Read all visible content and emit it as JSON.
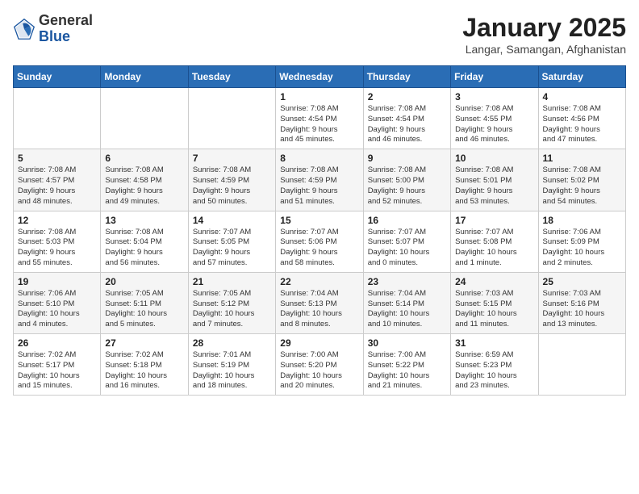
{
  "header": {
    "logo_general": "General",
    "logo_blue": "Blue",
    "title": "January 2025",
    "subtitle": "Langar, Samangan, Afghanistan"
  },
  "days_of_week": [
    "Sunday",
    "Monday",
    "Tuesday",
    "Wednesday",
    "Thursday",
    "Friday",
    "Saturday"
  ],
  "weeks": [
    [
      {
        "day": "",
        "info": ""
      },
      {
        "day": "",
        "info": ""
      },
      {
        "day": "",
        "info": ""
      },
      {
        "day": "1",
        "info": "Sunrise: 7:08 AM\nSunset: 4:54 PM\nDaylight: 9 hours\nand 45 minutes."
      },
      {
        "day": "2",
        "info": "Sunrise: 7:08 AM\nSunset: 4:54 PM\nDaylight: 9 hours\nand 46 minutes."
      },
      {
        "day": "3",
        "info": "Sunrise: 7:08 AM\nSunset: 4:55 PM\nDaylight: 9 hours\nand 46 minutes."
      },
      {
        "day": "4",
        "info": "Sunrise: 7:08 AM\nSunset: 4:56 PM\nDaylight: 9 hours\nand 47 minutes."
      }
    ],
    [
      {
        "day": "5",
        "info": "Sunrise: 7:08 AM\nSunset: 4:57 PM\nDaylight: 9 hours\nand 48 minutes."
      },
      {
        "day": "6",
        "info": "Sunrise: 7:08 AM\nSunset: 4:58 PM\nDaylight: 9 hours\nand 49 minutes."
      },
      {
        "day": "7",
        "info": "Sunrise: 7:08 AM\nSunset: 4:59 PM\nDaylight: 9 hours\nand 50 minutes."
      },
      {
        "day": "8",
        "info": "Sunrise: 7:08 AM\nSunset: 4:59 PM\nDaylight: 9 hours\nand 51 minutes."
      },
      {
        "day": "9",
        "info": "Sunrise: 7:08 AM\nSunset: 5:00 PM\nDaylight: 9 hours\nand 52 minutes."
      },
      {
        "day": "10",
        "info": "Sunrise: 7:08 AM\nSunset: 5:01 PM\nDaylight: 9 hours\nand 53 minutes."
      },
      {
        "day": "11",
        "info": "Sunrise: 7:08 AM\nSunset: 5:02 PM\nDaylight: 9 hours\nand 54 minutes."
      }
    ],
    [
      {
        "day": "12",
        "info": "Sunrise: 7:08 AM\nSunset: 5:03 PM\nDaylight: 9 hours\nand 55 minutes."
      },
      {
        "day": "13",
        "info": "Sunrise: 7:08 AM\nSunset: 5:04 PM\nDaylight: 9 hours\nand 56 minutes."
      },
      {
        "day": "14",
        "info": "Sunrise: 7:07 AM\nSunset: 5:05 PM\nDaylight: 9 hours\nand 57 minutes."
      },
      {
        "day": "15",
        "info": "Sunrise: 7:07 AM\nSunset: 5:06 PM\nDaylight: 9 hours\nand 58 minutes."
      },
      {
        "day": "16",
        "info": "Sunrise: 7:07 AM\nSunset: 5:07 PM\nDaylight: 10 hours\nand 0 minutes."
      },
      {
        "day": "17",
        "info": "Sunrise: 7:07 AM\nSunset: 5:08 PM\nDaylight: 10 hours\nand 1 minute."
      },
      {
        "day": "18",
        "info": "Sunrise: 7:06 AM\nSunset: 5:09 PM\nDaylight: 10 hours\nand 2 minutes."
      }
    ],
    [
      {
        "day": "19",
        "info": "Sunrise: 7:06 AM\nSunset: 5:10 PM\nDaylight: 10 hours\nand 4 minutes."
      },
      {
        "day": "20",
        "info": "Sunrise: 7:05 AM\nSunset: 5:11 PM\nDaylight: 10 hours\nand 5 minutes."
      },
      {
        "day": "21",
        "info": "Sunrise: 7:05 AM\nSunset: 5:12 PM\nDaylight: 10 hours\nand 7 minutes."
      },
      {
        "day": "22",
        "info": "Sunrise: 7:04 AM\nSunset: 5:13 PM\nDaylight: 10 hours\nand 8 minutes."
      },
      {
        "day": "23",
        "info": "Sunrise: 7:04 AM\nSunset: 5:14 PM\nDaylight: 10 hours\nand 10 minutes."
      },
      {
        "day": "24",
        "info": "Sunrise: 7:03 AM\nSunset: 5:15 PM\nDaylight: 10 hours\nand 11 minutes."
      },
      {
        "day": "25",
        "info": "Sunrise: 7:03 AM\nSunset: 5:16 PM\nDaylight: 10 hours\nand 13 minutes."
      }
    ],
    [
      {
        "day": "26",
        "info": "Sunrise: 7:02 AM\nSunset: 5:17 PM\nDaylight: 10 hours\nand 15 minutes."
      },
      {
        "day": "27",
        "info": "Sunrise: 7:02 AM\nSunset: 5:18 PM\nDaylight: 10 hours\nand 16 minutes."
      },
      {
        "day": "28",
        "info": "Sunrise: 7:01 AM\nSunset: 5:19 PM\nDaylight: 10 hours\nand 18 minutes."
      },
      {
        "day": "29",
        "info": "Sunrise: 7:00 AM\nSunset: 5:20 PM\nDaylight: 10 hours\nand 20 minutes."
      },
      {
        "day": "30",
        "info": "Sunrise: 7:00 AM\nSunset: 5:22 PM\nDaylight: 10 hours\nand 21 minutes."
      },
      {
        "day": "31",
        "info": "Sunrise: 6:59 AM\nSunset: 5:23 PM\nDaylight: 10 hours\nand 23 minutes."
      },
      {
        "day": "",
        "info": ""
      }
    ]
  ]
}
